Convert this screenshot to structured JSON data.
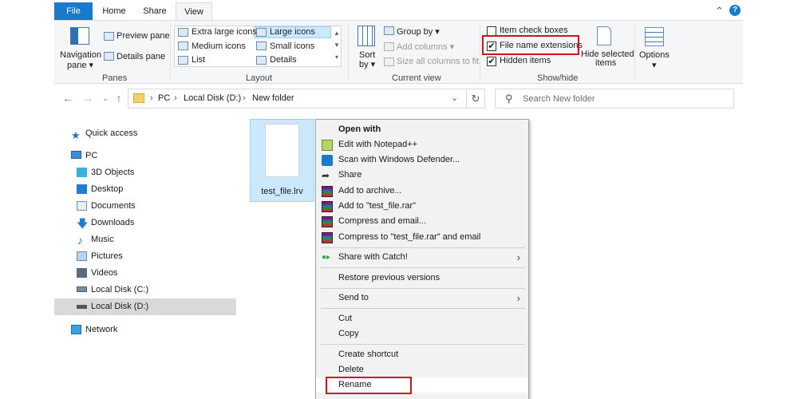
{
  "tabs": {
    "file": "File",
    "home": "Home",
    "share": "Share",
    "view": "View"
  },
  "ribbon": {
    "panes": {
      "navigation_pane": "Navigation",
      "navigation_pane_2": "pane",
      "preview_pane": "Preview pane",
      "details_pane": "Details pane",
      "label": "Panes"
    },
    "layout": {
      "extra_large_icons": "Extra large icons",
      "large_icons": "Large icons",
      "medium_icons": "Medium icons",
      "small_icons": "Small icons",
      "list": "List",
      "details": "Details",
      "label": "Layout"
    },
    "current_view": {
      "sort_by": "Sort",
      "sort_by_2": "by",
      "group_by": "Group by",
      "add_columns": "Add columns",
      "size_all_columns": "Size all columns to fit",
      "label": "Current view"
    },
    "show_hide": {
      "item_check_boxes": "Item check boxes",
      "file_name_extensions": "File name extensions",
      "hidden_items": "Hidden items",
      "hide_selected": "Hide selected",
      "hide_selected_2": "items",
      "label": "Show/hide"
    },
    "options": {
      "label": "Options"
    }
  },
  "address": {
    "path": [
      "PC",
      "Local Disk (D:)",
      "New folder"
    ],
    "search_placeholder": "Search New folder"
  },
  "sidebar": {
    "quick_access": "Quick access",
    "pc": "PC",
    "items": [
      "3D Objects",
      "Desktop",
      "Documents",
      "Downloads",
      "Music",
      "Pictures",
      "Videos",
      "Local Disk (C:)",
      "Local Disk (D:)"
    ],
    "network": "Network"
  },
  "file": {
    "name": "test_file.lrv"
  },
  "context_menu": {
    "open_with": "Open with",
    "edit_notepad": "Edit with Notepad++",
    "scan_defender": "Scan with Windows Defender...",
    "share": "Share",
    "add_archive": "Add to archive...",
    "add_rar": "Add to \"test_file.rar\"",
    "compress_email": "Compress and email...",
    "compress_rar_email": "Compress to \"test_file.rar\" and email",
    "share_catch": "Share with Catch!",
    "restore": "Restore previous versions",
    "send_to": "Send to",
    "cut": "Cut",
    "copy": "Copy",
    "create_shortcut": "Create shortcut",
    "delete": "Delete",
    "rename": "Rename"
  },
  "colors": {
    "accent": "#1979ca",
    "highlight": "#d0121b",
    "selection": "#cce8ff"
  }
}
